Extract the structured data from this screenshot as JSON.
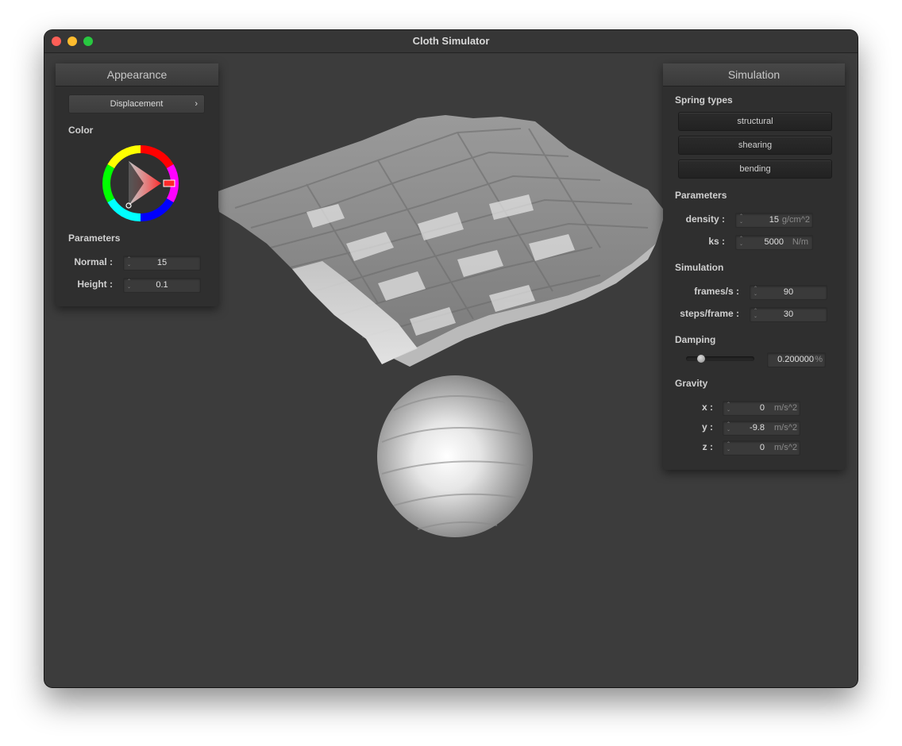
{
  "window": {
    "title": "Cloth Simulator"
  },
  "appearance": {
    "title": "Appearance",
    "shader_label": "Displacement",
    "color_label": "Color",
    "parameters_label": "Parameters",
    "normal": {
      "label": "Normal :",
      "value": "15"
    },
    "height": {
      "label": "Height :",
      "value": "0.1"
    }
  },
  "simulation": {
    "title": "Simulation",
    "spring_types_label": "Spring types",
    "springs": [
      "structural",
      "shearing",
      "bending"
    ],
    "parameters_label": "Parameters",
    "density": {
      "label": "density :",
      "value": "15",
      "unit": "g/cm^2"
    },
    "ks": {
      "label": "ks :",
      "value": "5000",
      "unit": "N/m"
    },
    "simulation_label": "Simulation",
    "fps": {
      "label": "frames/s :",
      "value": "90"
    },
    "steps": {
      "label": "steps/frame :",
      "value": "30"
    },
    "damping_label": "Damping",
    "damping": {
      "value": "0.200000",
      "unit": "%",
      "slider_fraction": 0.08
    },
    "gravity_label": "Gravity",
    "gravity": {
      "x": {
        "label": "x :",
        "value": "0",
        "unit": "m/s^2"
      },
      "y": {
        "label": "y :",
        "value": "-9.8",
        "unit": "m/s^2"
      },
      "z": {
        "label": "z :",
        "value": "0",
        "unit": "m/s^2"
      }
    }
  },
  "colors": {
    "background": "#3c3c3c",
    "panel": "#2f2f2f",
    "close": "#fe5f57",
    "minimize": "#febc2e",
    "zoom": "#28c840",
    "picker_selected": "#ff2a2a"
  }
}
